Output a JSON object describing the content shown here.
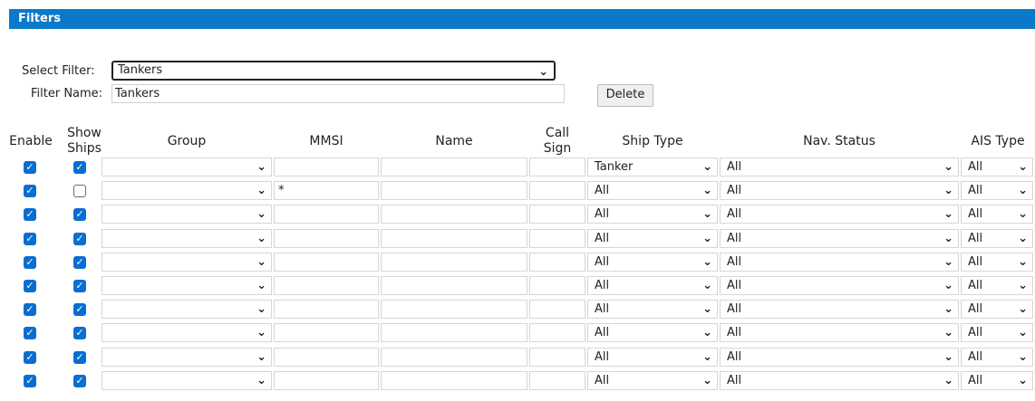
{
  "panel": {
    "title": "Filters"
  },
  "form": {
    "select_label": "Select Filter:",
    "select_value": "Tankers",
    "name_label": "Filter Name:",
    "name_value": "Tankers",
    "delete_label": "Delete"
  },
  "headers": {
    "enable": "Enable",
    "show_ships": [
      "Show",
      "Ships"
    ],
    "group": "Group",
    "mmsi": "MMSI",
    "name": "Name",
    "call_sign": [
      "Call",
      "Sign"
    ],
    "ship_type": "Ship Type",
    "nav_status": "Nav. Status",
    "ais_type": "AIS Type"
  },
  "icons": {
    "dropdown": "chevron-down-icon",
    "check": "checkmark-icon"
  },
  "colors": {
    "header_bar": "#0b79c9",
    "checkbox": "#0a6ed1"
  },
  "rows": [
    {
      "enable": true,
      "show": true,
      "group": "",
      "mmsi": "",
      "name": "",
      "call_sign": "",
      "ship_type": "Tanker",
      "nav_status": "All",
      "ais_type": "All"
    },
    {
      "enable": true,
      "show": false,
      "group": "",
      "mmsi": "*",
      "name": "",
      "call_sign": "",
      "ship_type": "All",
      "nav_status": "All",
      "ais_type": "All"
    },
    {
      "enable": true,
      "show": true,
      "group": "",
      "mmsi": "",
      "name": "",
      "call_sign": "",
      "ship_type": "All",
      "nav_status": "All",
      "ais_type": "All"
    },
    {
      "enable": true,
      "show": true,
      "group": "",
      "mmsi": "",
      "name": "",
      "call_sign": "",
      "ship_type": "All",
      "nav_status": "All",
      "ais_type": "All"
    },
    {
      "enable": true,
      "show": true,
      "group": "",
      "mmsi": "",
      "name": "",
      "call_sign": "",
      "ship_type": "All",
      "nav_status": "All",
      "ais_type": "All"
    },
    {
      "enable": true,
      "show": true,
      "group": "",
      "mmsi": "",
      "name": "",
      "call_sign": "",
      "ship_type": "All",
      "nav_status": "All",
      "ais_type": "All"
    },
    {
      "enable": true,
      "show": true,
      "group": "",
      "mmsi": "",
      "name": "",
      "call_sign": "",
      "ship_type": "All",
      "nav_status": "All",
      "ais_type": "All"
    },
    {
      "enable": true,
      "show": true,
      "group": "",
      "mmsi": "",
      "name": "",
      "call_sign": "",
      "ship_type": "All",
      "nav_status": "All",
      "ais_type": "All"
    },
    {
      "enable": true,
      "show": true,
      "group": "",
      "mmsi": "",
      "name": "",
      "call_sign": "",
      "ship_type": "All",
      "nav_status": "All",
      "ais_type": "All"
    },
    {
      "enable": true,
      "show": true,
      "group": "",
      "mmsi": "",
      "name": "",
      "call_sign": "",
      "ship_type": "All",
      "nav_status": "All",
      "ais_type": "All"
    }
  ]
}
